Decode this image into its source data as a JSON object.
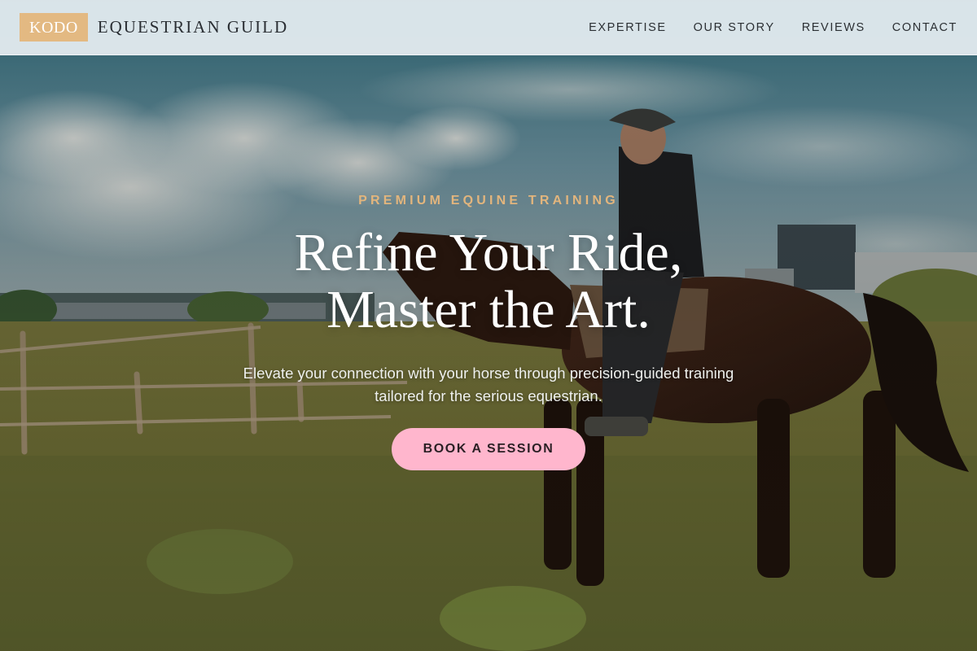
{
  "header": {
    "logo_mark": "KODO",
    "logo_text": "EQUESTRIAN GUILD",
    "nav": [
      {
        "label": "EXPERTISE"
      },
      {
        "label": "OUR STORY"
      },
      {
        "label": "REVIEWS"
      },
      {
        "label": "CONTACT"
      }
    ]
  },
  "hero": {
    "eyebrow": "PREMIUM EQUINE TRAINING",
    "headline_line1": "Refine Your Ride,",
    "headline_line2": "Master the Art.",
    "subtext": "Elevate your connection with your horse through precision-guided training tailored for the serious equestrian.",
    "cta_label": "BOOK A SESSION",
    "background_image": "rider-on-horse-in-field-photo"
  },
  "colors": {
    "accent_gold": "#e2b57d",
    "logo_bg": "#e3b982",
    "cta_pink": "#ffb6cd",
    "header_bg": "#e6eef2"
  }
}
